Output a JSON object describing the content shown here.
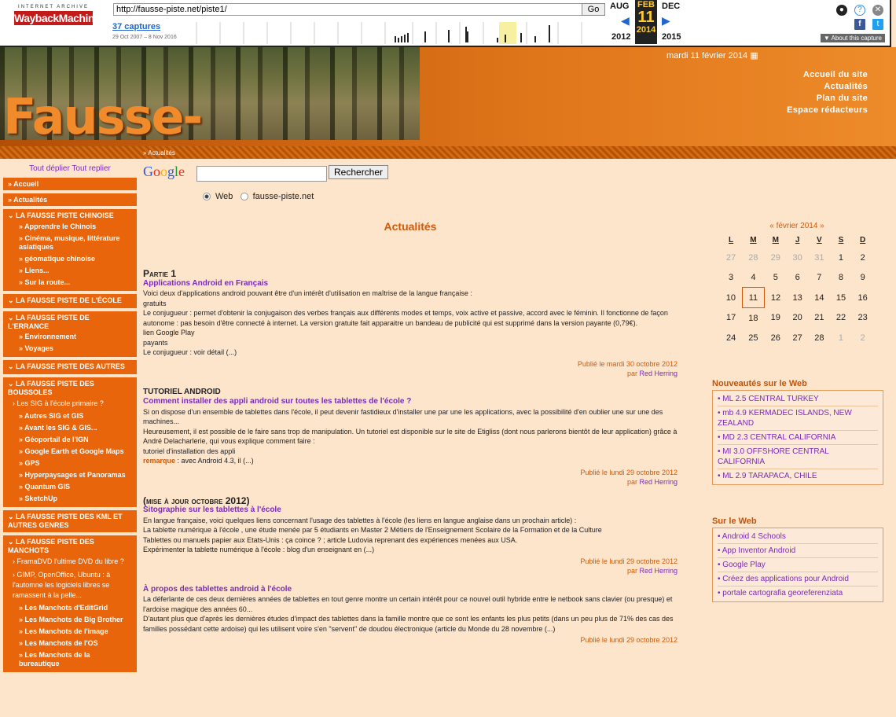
{
  "wayback": {
    "logo_top": "INTERNET ARCHIVE",
    "logo_main": "WaybackMachine",
    "url": "http://fausse-piste.net/piste1/",
    "go_label": "Go",
    "captures": "37 captures",
    "range": "29 Oct 2007 – 8 Nov 2016",
    "prev_month": "AUG",
    "cur_month": "FEB",
    "next_month": "DEC",
    "cur_day": "11",
    "prev_year": "2012",
    "cur_year": "2014",
    "next_year": "2015",
    "about": "▼ About this capture"
  },
  "header": {
    "logo": "Fausse-Piste.net",
    "date": "mardi 11 février 2014",
    "nav": [
      "Accueil du site",
      "Actualités",
      "Plan du site",
      "Espace rédacteurs"
    ]
  },
  "breadcrumb": "» Actualités",
  "sidebar": {
    "tools": "Tout déplier Tout replier",
    "top": [
      "Accueil",
      "Actualités"
    ],
    "groups": [
      {
        "head": "LA FAUSSE PISTE CHINOISE",
        "items": [
          "Apprendre le Chinois",
          "Cinéma, musique, littérature asiatiques",
          "géomatique chinoise",
          "Liens...",
          "Sur la route..."
        ]
      },
      {
        "head": "LA FAUSSE PISTE DE L'ÉCOLE",
        "items": []
      },
      {
        "head": "LA FAUSSE PISTE DE L'ERRANCE",
        "items": [
          "Environnement",
          "Voyages"
        ]
      },
      {
        "head": "LA FAUSSE PISTE DES AUTRES",
        "items": []
      },
      {
        "head": "LA FAUSSE PISTE DES BOUSSOLES",
        "plain": [
          "Les SIG à l'école primaire ?"
        ],
        "items": [
          "Autres SIG et GIS",
          "Avant les SIG & GIS...",
          "Géoportail de l'IGN",
          "Google Earth et Google Maps",
          "GPS",
          "Hyperpaysages et Panoramas",
          "Quantum GIS",
          "SketchUp"
        ]
      },
      {
        "head": "LA FAUSSE PISTE DES KML ET AUTRES GENRES",
        "items": []
      },
      {
        "head": "LA FAUSSE PISTE DES MANCHOTS",
        "plain": [
          "FramaDVD l'ultime DVD du libre ?",
          "GIMP, OpenOffice, Ubuntu : à l'automne les logiciels libres se ramassent à la pelle..."
        ],
        "items": [
          "Les Manchots d'EditGrid",
          "Les Manchots de Big Brother",
          "Les Manchots de l'image",
          "Les Manchots de l'OS",
          "Les Manchots de la bureautique"
        ]
      }
    ]
  },
  "search": {
    "logo": "Google",
    "button": "Rechercher",
    "opt_web": "Web",
    "opt_site": "fausse-piste.net"
  },
  "main": {
    "title": "Actualités",
    "articles": [
      {
        "section": "Partie 1",
        "title": "Applications Android en Français",
        "body": [
          "Voici deux d'applications android pouvant être d'un intérêt d'utilisation en maîtrise de la langue française :",
          "gratuits",
          "Le conjugueur : permet d'obtenir la conjugaison des verbes français aux différents modes et temps, voix active et passive, accord avec le féminin. Il fonctionne de façon autonome : pas besoin d'être connecté à internet. La version gratuite fait apparaitre un bandeau de publicité qui est supprimé dans la version payante (0,79€).",
          "lien Google Play",
          "payants",
          "Le conjugueur : voir détail (...)"
        ],
        "published": "Publié le mardi 30 octobre 2012",
        "by_prefix": "par ",
        "author": "Red Herring"
      },
      {
        "section": "TUTORIEL ANDROID",
        "title": "Comment installer des appli android sur toutes les tablettes de l'école ?",
        "body": [
          "Si on dispose d'un ensemble de tablettes dans l'école, il peut devenir fastidieux d'installer une par une les applications, avec la possibilité d'en oublier une sur une des machines...",
          "Heureusement, il est possible de le faire sans trop de manipulation. Un tutoriel est disponible sur le site de Etigliss (dont nous parlerons bientôt de leur application) grâce à André Delacharlerie, qui vous explique comment faire :",
          "tutoriel d'installation des appli"
        ],
        "remark_label": "remarque",
        "remark_text": " : avec Android 4.3, il (...)",
        "published": "Publié le lundi 29 octobre 2012",
        "by_prefix": "par ",
        "author": "Red Herring"
      },
      {
        "section": "(mise à jour octobre 2012)",
        "title": "Sitographie sur les tablettes à l'école",
        "body": [
          "En langue française, voici quelques liens concernant l'usage des tablettes à l'école (les liens en langue anglaise dans un prochain article) :",
          "La tablette numérique à l'école , une étude menée par 5 étudiants en Master 2 Métiers de l'Enseignement Scolaire de la Formation et de la Culture",
          "Tablettes ou manuels papier aux Etats-Unis : ça coince ? ; article Ludovia reprenant des expériences menées aux USA.",
          "Expérimenter la tablette numérique à l'école : blog d'un enseignant en (...)"
        ],
        "published": "Publié le lundi 29 octobre 2012",
        "by_prefix": "par ",
        "author": "Red Herring"
      },
      {
        "section": "",
        "title": "À propos des tablettes android à l'école",
        "body": [
          "La déferlante de ces deux dernières années de tablettes en tout genre montre un certain intérêt pour ce nouvel outil hybride entre le netbook sans clavier (ou presque) et l'ardoise magique des années 60...",
          "D'autant plus que d'après les dernières études d'impact des tablettes dans la famille montre que ce sont les enfants les plus petits (dans un peu plus de 71% des cas des familles possédant cette ardoise) qui les utilisent voire s'en \"servent\" de doudou électronique (article du Monde du 28 novembre (...)"
        ],
        "published": "Publié le lundi 29 octobre 2012",
        "by_prefix": "",
        "author": ""
      }
    ]
  },
  "calendar": {
    "month": "« février 2014 »",
    "days": [
      "L",
      "M",
      "M",
      "J",
      "V",
      "S",
      "D"
    ],
    "weeks": [
      [
        "27",
        "28",
        "29",
        "30",
        "31",
        "1",
        "2"
      ],
      [
        "3",
        "4",
        "5",
        "6",
        "7",
        "8",
        "9"
      ],
      [
        "10",
        "11",
        "12",
        "13",
        "14",
        "15",
        "16"
      ],
      [
        "17",
        "18",
        "19",
        "20",
        "21",
        "22",
        "23"
      ],
      [
        "24",
        "25",
        "26",
        "27",
        "28",
        "1",
        "2"
      ]
    ],
    "today": "11"
  },
  "news": {
    "title": "Nouveautés sur le Web",
    "items": [
      "ML 2.5 CENTRAL TURKEY",
      "mb 4.9 KERMADEC ISLANDS, NEW ZEALAND",
      "MD 2.3 CENTRAL CALIFORNIA",
      "MI 3.0 OFFSHORE CENTRAL CALIFORNIA",
      "ML 2.9 TARAPACA, CHILE"
    ]
  },
  "web": {
    "title": "Sur le Web",
    "items": [
      "Android 4 Schools",
      "App Inventor Android",
      "Google Play",
      "Créez des applications pour Android",
      "portale cartografia georeferenziata"
    ]
  },
  "colors": {
    "accent": "#e8650c",
    "link": "#7a2bb5",
    "bg": "#fde5cc"
  }
}
